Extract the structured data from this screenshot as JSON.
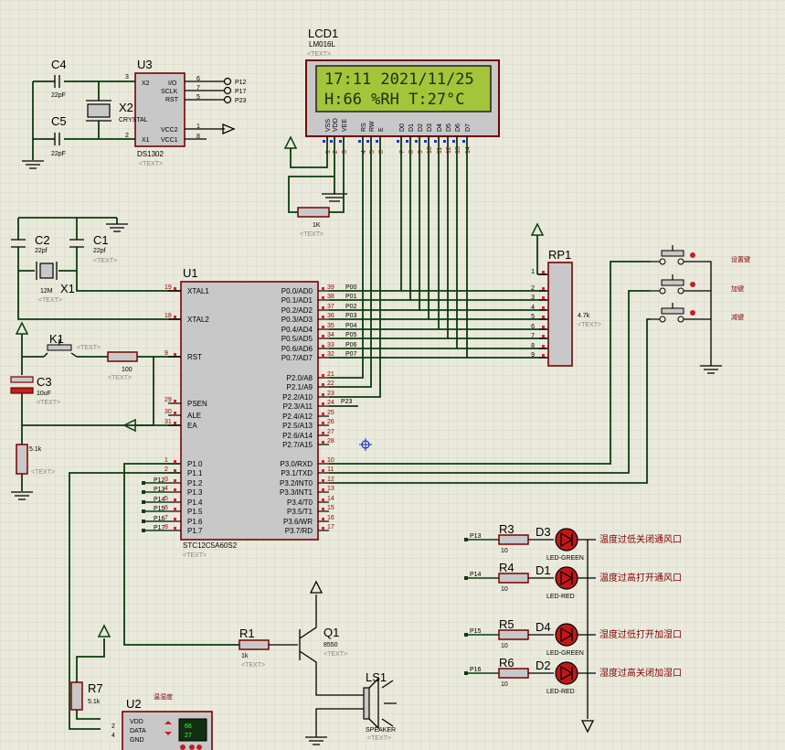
{
  "lcd": {
    "ref": "LCD1",
    "model": "LM016L",
    "text_tag": "<TEXT>",
    "line1": "17:11 2021/11/25",
    "line2": "H:66 %RH T:27°C",
    "pins": [
      "VSS",
      "VDD",
      "VEE",
      "RS",
      "RW",
      "E",
      "D0",
      "D1",
      "D2",
      "D3",
      "D4",
      "D5",
      "D6",
      "D7"
    ],
    "pin_nums": [
      "1",
      "2",
      "3",
      "4",
      "5",
      "6",
      "7",
      "8",
      "9",
      "10",
      "11",
      "12",
      "13",
      "14"
    ]
  },
  "u3": {
    "ref": "U3",
    "model": "DS1302",
    "text_tag": "<TEXT>",
    "pins_left": [
      "X2",
      "X1"
    ],
    "pins_right": [
      "I/O",
      "SCLK",
      "RST",
      "VCC2",
      "VCC1"
    ],
    "nums_left": [
      "3",
      "2"
    ],
    "nums_right": [
      "6",
      "7",
      "5",
      "1",
      "8"
    ],
    "nets": [
      "P12",
      "P17",
      "P23"
    ]
  },
  "x2": {
    "ref": "X2",
    "model": "CRYSTAL",
    "text_tag": "<TEXT>"
  },
  "c4": {
    "ref": "C4",
    "value": "22pF"
  },
  "c5": {
    "ref": "C5",
    "value": "22pF"
  },
  "c2": {
    "ref": "C2",
    "value": "22pf",
    "text_tag": "<TEXT>"
  },
  "c1": {
    "ref": "C1",
    "value": "22pf",
    "text_tag": "<TEXT>"
  },
  "x1": {
    "ref": "X1",
    "value": "12M",
    "text_tag": "<TEXT>"
  },
  "k1": {
    "ref": "K1",
    "text_tag": "<TEXT>"
  },
  "r_rst": {
    "value": "100",
    "text_tag": "<TEXT>"
  },
  "c3": {
    "ref": "C3",
    "value": "10uF",
    "text_tag": "<TEXT>"
  },
  "r_5k1": {
    "value": "5.1k",
    "text_tag": "<TEXT>"
  },
  "r_1k_lcd": {
    "value": "1K",
    "text_tag": "<TEXT>"
  },
  "u1": {
    "ref": "U1",
    "model": "STC12C5A60S2",
    "text_tag": "<TEXT>",
    "left_pins": [
      {
        "name": "XTAL1",
        "num": "19"
      },
      {
        "name": "XTAL2",
        "num": "18"
      },
      {
        "name": "RST",
        "num": "9"
      },
      {
        "name": "PSEN",
        "num": "29"
      },
      {
        "name": "ALE",
        "num": "30"
      },
      {
        "name": "EA",
        "num": "31"
      },
      {
        "name": "P1.0",
        "num": "1"
      },
      {
        "name": "P1.1",
        "num": "2"
      },
      {
        "name": "P1.2",
        "num": "3"
      },
      {
        "name": "P1.3",
        "num": "4"
      },
      {
        "name": "P1.4",
        "num": "5"
      },
      {
        "name": "P1.5",
        "num": "6"
      },
      {
        "name": "P1.6",
        "num": "7"
      },
      {
        "name": "P1.7",
        "num": "8"
      }
    ],
    "right_pins": [
      {
        "name": "P0.0/AD0",
        "num": "39"
      },
      {
        "name": "P0.1/AD1",
        "num": "38"
      },
      {
        "name": "P0.2/AD2",
        "num": "37"
      },
      {
        "name": "P0.3/AD3",
        "num": "36"
      },
      {
        "name": "P0.4/AD4",
        "num": "35"
      },
      {
        "name": "P0.5/AD5",
        "num": "34"
      },
      {
        "name": "P0.6/AD6",
        "num": "33"
      },
      {
        "name": "P0.7/AD7",
        "num": "32"
      },
      {
        "name": "P2.0/A8",
        "num": "21"
      },
      {
        "name": "P2.1/A9",
        "num": "22"
      },
      {
        "name": "P2.2/A10",
        "num": "23"
      },
      {
        "name": "P2.3/A11",
        "num": "24"
      },
      {
        "name": "P2.4/A12",
        "num": "25"
      },
      {
        "name": "P2.5/A13",
        "num": "26"
      },
      {
        "name": "P2.6/A14",
        "num": "27"
      },
      {
        "name": "P2.7/A15",
        "num": "28"
      },
      {
        "name": "P3.0/RXD",
        "num": "10"
      },
      {
        "name": "P3.1/TXD",
        "num": "11"
      },
      {
        "name": "P3.2/INT0",
        "num": "12"
      },
      {
        "name": "P3.3/INT1",
        "num": "13"
      },
      {
        "name": "P3.4/T0",
        "num": "14"
      },
      {
        "name": "P3.5/T1",
        "num": "15"
      },
      {
        "name": "P3.6/WR",
        "num": "16"
      },
      {
        "name": "P3.7/RD",
        "num": "17"
      }
    ],
    "p0_nets": [
      "P00",
      "P01",
      "P02",
      "P03",
      "P04",
      "P05",
      "P06",
      "P07"
    ],
    "p1_nets": [
      "P12",
      "P13",
      "P14",
      "P15",
      "P16",
      "P17"
    ],
    "p23_net": "P23"
  },
  "rp1": {
    "ref": "RP1",
    "value": "4.7k",
    "text_tag": "<TEXT>",
    "pins": [
      "1",
      "2",
      "3",
      "4",
      "5",
      "6",
      "7",
      "8",
      "9"
    ]
  },
  "buttons": [
    {
      "label": "设置键"
    },
    {
      "label": "加键"
    },
    {
      "label": "减键"
    }
  ],
  "leds": [
    {
      "r_ref": "R3",
      "r_val": "10",
      "d_ref": "D3",
      "d_type": "LED-GREEN",
      "net": "P13",
      "label": "温度过低关闭通风口"
    },
    {
      "r_ref": "R4",
      "r_val": "10",
      "d_ref": "D1",
      "d_type": "LED-RED",
      "net": "P14",
      "label": "温度过高打开通风口"
    },
    {
      "r_ref": "R5",
      "r_val": "10",
      "d_ref": "D4",
      "d_type": "LED-GREEN",
      "net": "P15",
      "label": "湿度过低打开加湿口"
    },
    {
      "r_ref": "R6",
      "r_val": "10",
      "d_ref": "D2",
      "d_type": "LED-RED",
      "net": "P16",
      "label": "湿度过高关闭加湿口"
    }
  ],
  "r1": {
    "ref": "R1",
    "value": "1k",
    "text_tag": "<TEXT>"
  },
  "q1": {
    "ref": "Q1",
    "model": "8550",
    "text_tag": "<TEXT>"
  },
  "ls1": {
    "ref": "LS1",
    "model": "SPEAKER",
    "text_tag": "<TEXT>"
  },
  "r7": {
    "ref": "R7",
    "value": "5.1k",
    "text_tag": "<TEXT>"
  },
  "u2": {
    "ref": "U2",
    "label": "温湿度",
    "pins": [
      "VDD",
      "DATA",
      "GND"
    ],
    "nums": [
      "2",
      "4"
    ],
    "display_top": "66",
    "display_bottom": "27"
  }
}
